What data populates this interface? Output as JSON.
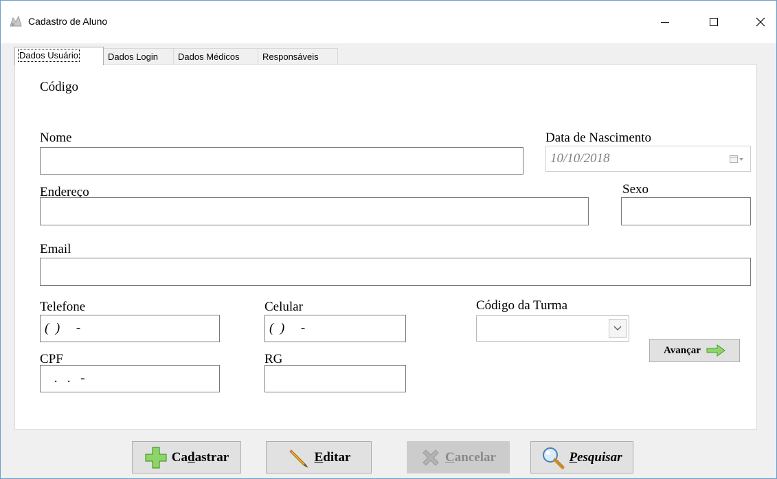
{
  "window": {
    "title": "Cadastro de Aluno",
    "minimize_label": "—",
    "maximize_label": "☐",
    "close_label": "✕"
  },
  "tabs": [
    {
      "label": "Dados Usuário",
      "active": true
    },
    {
      "label": "Dados Login",
      "active": false
    },
    {
      "label": "Dados Médicos",
      "active": false
    },
    {
      "label": "Responsáveis",
      "active": false
    }
  ],
  "form": {
    "codigo_label": "Código",
    "nome_label": "Nome",
    "nome_value": "",
    "data_nascimento_label": "Data de Nascimento",
    "data_nascimento_value": "10/10/2018",
    "endereco_label": "Endereço",
    "endereco_value": "",
    "sexo_label": "Sexo",
    "sexo_value": "",
    "email_label": "Email",
    "email_value": "",
    "telefone_label": "Telefone",
    "telefone_value": "(  )     -",
    "celular_label": "Celular",
    "celular_value": "(  )     -",
    "codigo_turma_label": "Código da Turma",
    "codigo_turma_value": "",
    "cpf_label": "CPF",
    "cpf_value": "   .   .   -",
    "rg_label": "RG",
    "rg_value": ""
  },
  "advance_button": {
    "label": "Avançar",
    "icon": "arrow-right-icon"
  },
  "actions": {
    "cadastrar": {
      "pre": "Ca",
      "key": "d",
      "post": "astrar",
      "icon": "plus-icon"
    },
    "editar": {
      "key": "E",
      "post": "ditar",
      "icon": "pencil-icon"
    },
    "cancelar": {
      "key": "C",
      "post": "ancelar",
      "icon": "x-icon",
      "disabled": true
    },
    "pesquisar": {
      "key": "P",
      "post": "esquisar",
      "icon": "magnifier-icon"
    }
  },
  "colors": {
    "accent_green": "#6cc644",
    "border": "#7a7a7a",
    "disabled": "#cccccc"
  }
}
